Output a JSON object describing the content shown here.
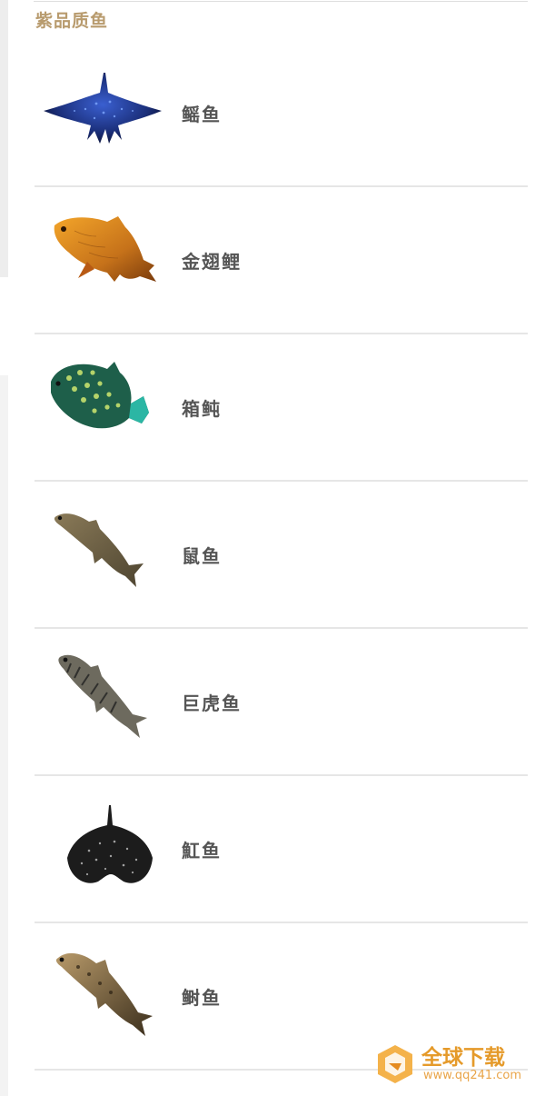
{
  "section": {
    "title": "紫品质鱼"
  },
  "fish": [
    {
      "name": "鳐鱼",
      "icon": "manta-ray-icon"
    },
    {
      "name": "金翅鲤",
      "icon": "golden-carp-icon"
    },
    {
      "name": "箱鲀",
      "icon": "boxfish-icon"
    },
    {
      "name": "鼠鱼",
      "icon": "ratfish-icon"
    },
    {
      "name": "巨虎鱼",
      "icon": "tigerfish-icon"
    },
    {
      "name": "魟鱼",
      "icon": "stingray-icon"
    },
    {
      "name": "鲥鱼",
      "icon": "shad-icon"
    }
  ],
  "watermark": {
    "brand": "全球下载",
    "site": "www.qq241.com"
  },
  "colors": {
    "header": "#b89b6e",
    "text": "#555555",
    "divider": "#e6e6e6",
    "watermark": "#e59a2a"
  }
}
